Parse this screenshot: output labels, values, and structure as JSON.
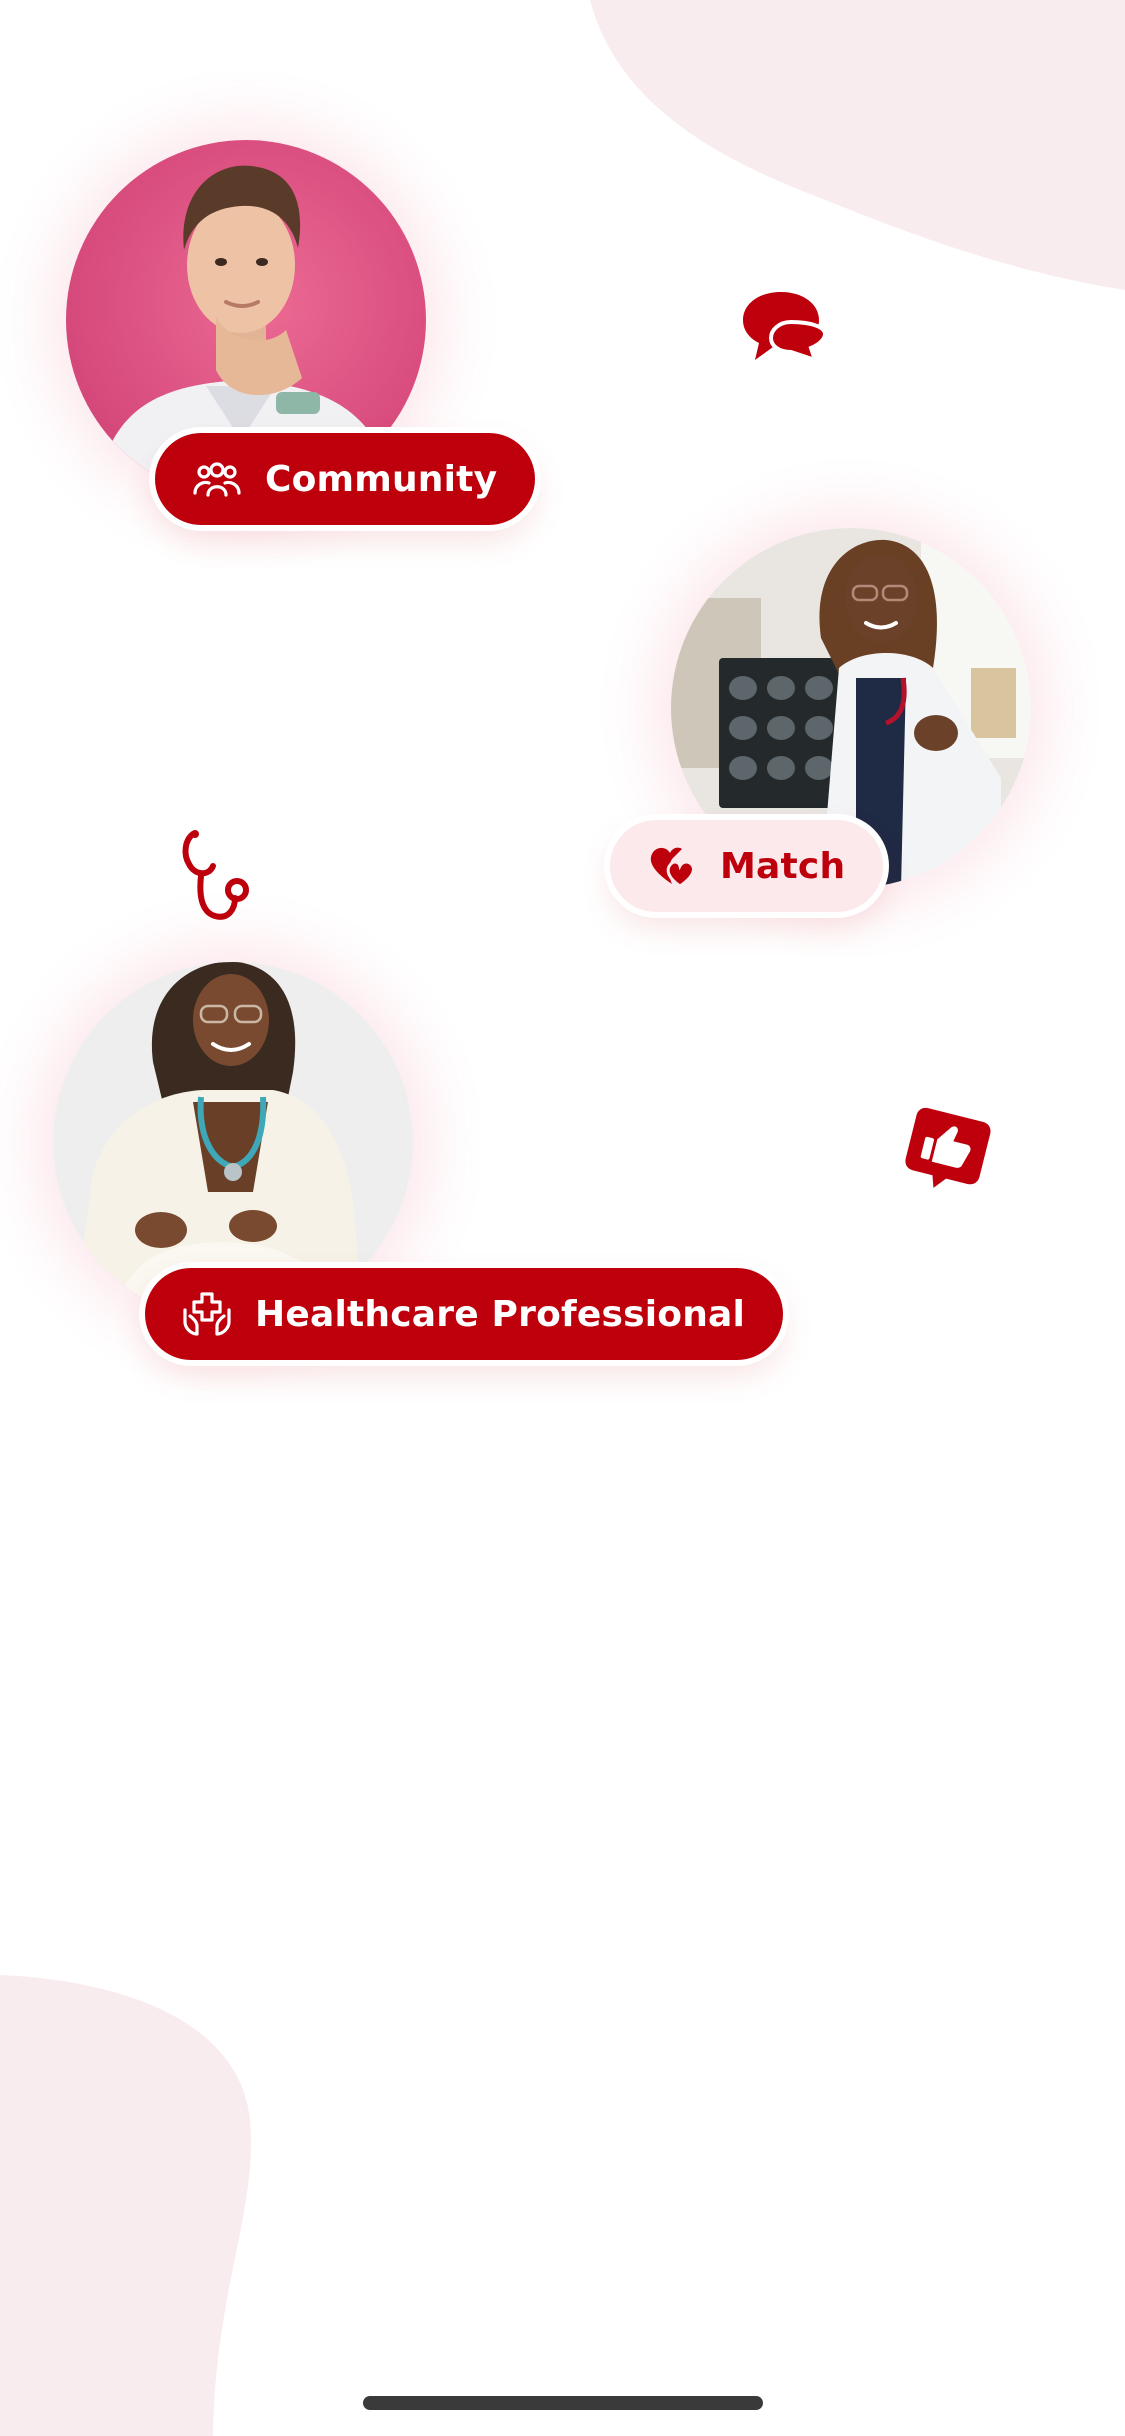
{
  "colors": {
    "brand_red": "#bd000c",
    "light_pink": "#fbe9ec",
    "blob": "#f9ecee",
    "background": "#ffffff"
  },
  "onboarding": {
    "community": {
      "label": "Community",
      "icon": "people-group-icon",
      "photo": "doctor-man-pink-background-photo"
    },
    "match": {
      "label": "Match",
      "icon": "hearts-icon",
      "photo": "doctor-woman-xray-photo"
    },
    "healthcare": {
      "label": "Healthcare Professional",
      "icon": "hands-medical-cross-icon",
      "photo": "doctor-woman-white-suit-photo"
    }
  },
  "decorations": {
    "chat": "chat-bubbles-icon",
    "stethoscope": "stethoscope-icon",
    "like": "thumbs-up-icon"
  }
}
